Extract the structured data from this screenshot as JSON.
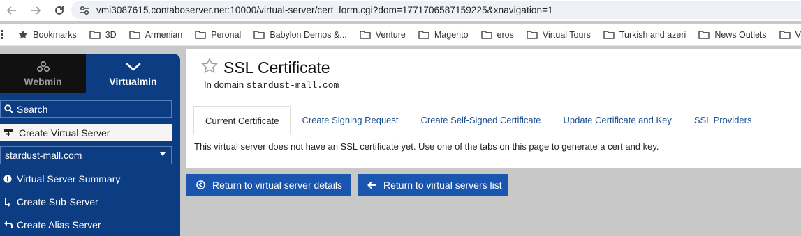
{
  "browser": {
    "url": "vmi3087615.contaboserver.net:10000/virtual-server/cert_form.cgi?dom=1771706587159225&xnavigation=1",
    "bookmarks": [
      {
        "label": "Bookmarks",
        "icon": "star-icon"
      },
      {
        "label": "3D",
        "icon": "folder-icon"
      },
      {
        "label": "Armenian",
        "icon": "folder-icon"
      },
      {
        "label": "Peronal",
        "icon": "folder-icon"
      },
      {
        "label": "Babylon Demos &...",
        "icon": "folder-icon"
      },
      {
        "label": "Venture",
        "icon": "folder-icon"
      },
      {
        "label": "Magento",
        "icon": "folder-icon"
      },
      {
        "label": "eros",
        "icon": "folder-icon"
      },
      {
        "label": "Virtual Tours",
        "icon": "folder-icon"
      },
      {
        "label": "Turkish and azeri",
        "icon": "folder-icon"
      },
      {
        "label": "News Outlets",
        "icon": "folder-icon"
      },
      {
        "label": "V",
        "icon": "folder-icon"
      }
    ]
  },
  "sidebar": {
    "webmin_label": "Webmin",
    "virtualmin_label": "Virtualmin",
    "search_label": "Search",
    "create_label": "Create Virtual Server",
    "selected_domain": "stardust-mall.com",
    "items": [
      {
        "label": "Virtual Server Summary",
        "icon": "info-icon"
      },
      {
        "label": "Create Sub-Server",
        "icon": "sub-server-icon"
      },
      {
        "label": "Create Alias Server",
        "icon": "alias-icon"
      }
    ]
  },
  "main": {
    "title": "SSL Certificate",
    "subtitle_prefix": "In domain",
    "domain": "stardust-mall.com",
    "tabs": [
      {
        "label": "Current Certificate",
        "active": true
      },
      {
        "label": "Create Signing Request",
        "active": false
      },
      {
        "label": "Create Self-Signed Certificate",
        "active": false
      },
      {
        "label": "Update Certificate and Key",
        "active": false
      },
      {
        "label": "SSL Providers",
        "active": false
      }
    ],
    "notice": "This virtual server does not have an SSL certificate yet. Use one of the tabs on this page to generate a cert and key.",
    "buttons": [
      {
        "label": "Return to virtual server details",
        "icon": "circle-left-icon"
      },
      {
        "label": "Return to virtual servers list",
        "icon": "arrow-left-icon"
      }
    ]
  },
  "colors": {
    "sidebar_bg": "#0c3d83",
    "button_bg": "#1a56b0",
    "link": "#1b4f91"
  }
}
